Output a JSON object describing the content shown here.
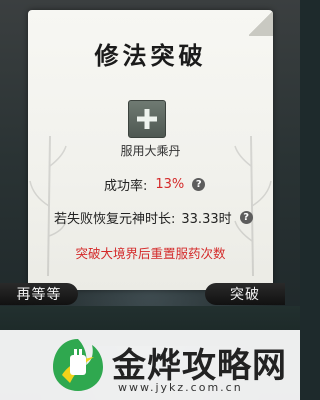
{
  "dialog": {
    "title": "修法突破",
    "item_label": "服用大乘丹",
    "success_rate_label": "成功率:",
    "success_rate_value": "13%",
    "fail_recovery_label": "若失败恢复元神时长:",
    "fail_recovery_value": "33.33时",
    "warning": "突破大境界后重置服药次数"
  },
  "buttons": {
    "wait": "再等等",
    "breakthrough": "突破"
  },
  "watermark": {
    "title": "金烨攻略网",
    "url": "www.jykz.com.cn"
  },
  "colors": {
    "accent_red": "#d42a2a",
    "dialog_bg": "#f4f4ef",
    "button_bg": "#1a1a1a"
  },
  "icons": [
    "plus-icon",
    "help-icon",
    "help-icon",
    "bamboo-decoration",
    "watermark-logo-icon"
  ]
}
